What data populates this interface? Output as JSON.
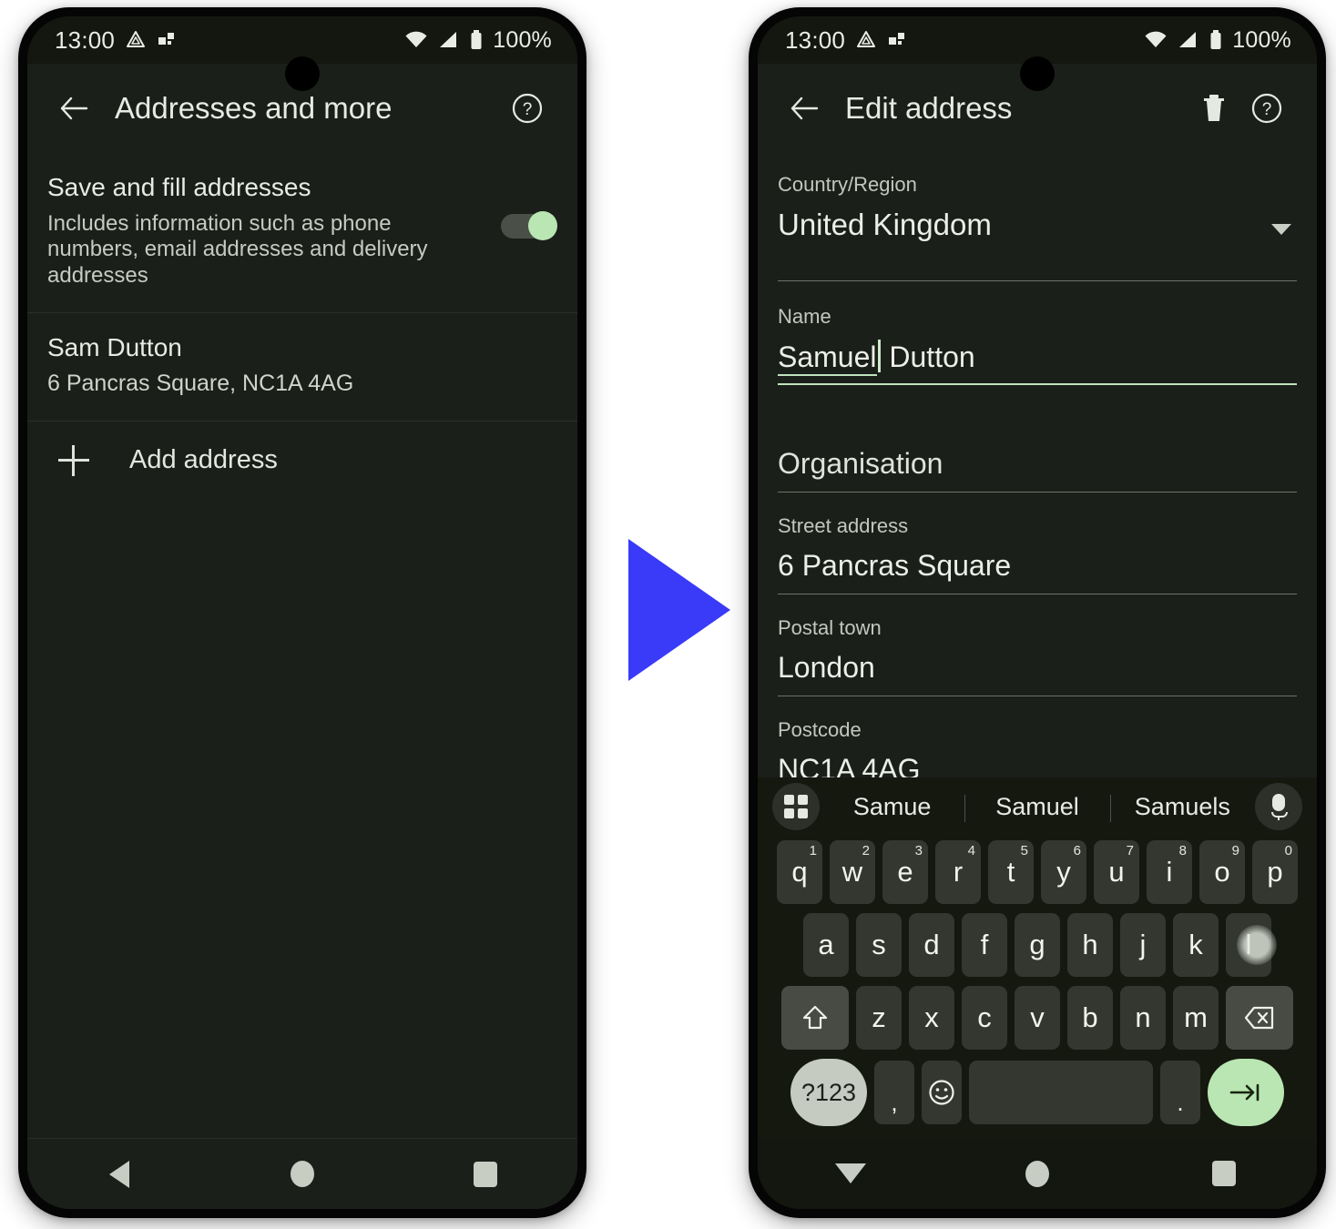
{
  "status_bar": {
    "time": "13:00",
    "battery_percent": "100%",
    "icons": [
      "drive-icon",
      "shapes-icon",
      "wifi-icon",
      "signal-icon",
      "battery-icon"
    ]
  },
  "left_phone": {
    "app_bar": {
      "back_label": "back-arrow",
      "title": "Addresses and more",
      "help_label": "help"
    },
    "setting": {
      "title": "Save and fill addresses",
      "subtitle": "Includes information such as phone numbers, email addresses and delivery addresses",
      "toggle_state": "on"
    },
    "saved_address": {
      "name": "Sam Dutton",
      "line": "6 Pancras Square, NC1A 4AG"
    },
    "add_address": {
      "label": "Add address"
    },
    "nav": {
      "back": "back",
      "home": "home",
      "recents": "recents"
    }
  },
  "right_phone": {
    "app_bar": {
      "title": "Edit address",
      "delete_label": "delete",
      "help_label": "help"
    },
    "fields": {
      "country": {
        "label": "Country/Region",
        "value": "United Kingdom"
      },
      "name": {
        "label": "Name",
        "composing": "Samuel",
        "rest": " Dutton"
      },
      "organisation": {
        "label": "",
        "value": "Organisation"
      },
      "street": {
        "label": "Street address",
        "value": "6 Pancras Square"
      },
      "town": {
        "label": "Postal town",
        "value": "London"
      },
      "postcode": {
        "label": "Postcode",
        "value": "NC1A 4AG"
      }
    },
    "keyboard": {
      "suggestions": [
        "Samue",
        "Samuel",
        "Samuels"
      ],
      "row1": [
        {
          "k": "q",
          "n": "1"
        },
        {
          "k": "w",
          "n": "2"
        },
        {
          "k": "e",
          "n": "3"
        },
        {
          "k": "r",
          "n": "4"
        },
        {
          "k": "t",
          "n": "5"
        },
        {
          "k": "y",
          "n": "6"
        },
        {
          "k": "u",
          "n": "7"
        },
        {
          "k": "i",
          "n": "8"
        },
        {
          "k": "o",
          "n": "9"
        },
        {
          "k": "p",
          "n": "0"
        }
      ],
      "row2": [
        "a",
        "s",
        "d",
        "f",
        "g",
        "h",
        "j",
        "k",
        "l"
      ],
      "row2_pressed": "l",
      "row3": [
        "z",
        "x",
        "c",
        "v",
        "b",
        "n",
        "m"
      ],
      "shift_label": "shift",
      "backspace_label": "backspace",
      "symbols_label": "?123",
      "comma_label": ",",
      "emoji_label": "emoji",
      "space_label": "space",
      "period_label": ".",
      "enter_label": "next"
    },
    "nav": {
      "dismiss": "hide-keyboard",
      "home": "home",
      "recents": "recents"
    }
  },
  "arrow": {
    "label": "flow-arrow",
    "color": "#3a3af9"
  }
}
